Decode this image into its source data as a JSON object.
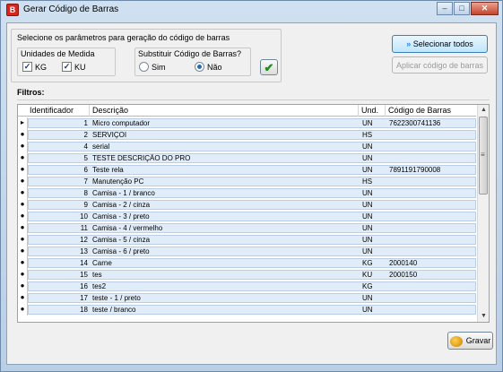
{
  "window": {
    "title": "Gerar Código de Barras",
    "app_icon_glyph": "B",
    "controls": {
      "minimize": "–",
      "maximize": "□",
      "close": "✕"
    }
  },
  "params": {
    "heading": "Selecione os parâmetros para geração do código de barras",
    "units_group_label": "Unidades de Medida",
    "unit_options": [
      {
        "label": "KG",
        "checked": true
      },
      {
        "label": "KU",
        "checked": true
      }
    ],
    "substituir_label": "Substituir Código de Barras?",
    "radio_sim": "Sim",
    "radio_nao": "Não",
    "selected": "Não"
  },
  "buttons": {
    "select_all": "Selecionar todos",
    "apply_barcode": "Aplicar código de barras",
    "save": "Gravar"
  },
  "filters_label": "Filtros:",
  "grid": {
    "columns": [
      "Identificador",
      "Descrição",
      "Und.",
      "Código de Barras"
    ],
    "rows": [
      {
        "id": "1",
        "desc": "Micro computador",
        "und": "UN",
        "barcode": "7622300741136",
        "indicator": "arrow"
      },
      {
        "id": "2",
        "desc": "SERVIÇOI",
        "und": "HS",
        "barcode": "",
        "indicator": "dot"
      },
      {
        "id": "4",
        "desc": "serial",
        "und": "UN",
        "barcode": "",
        "indicator": "dot"
      },
      {
        "id": "5",
        "desc": "TESTE DESCRIÇÃO DO PRO",
        "und": "UN",
        "barcode": "",
        "indicator": "dot"
      },
      {
        "id": "6",
        "desc": "Teste rela",
        "und": "UN",
        "barcode": "7891191790008",
        "indicator": "dot"
      },
      {
        "id": "7",
        "desc": "Manutenção PC",
        "und": "HS",
        "barcode": "",
        "indicator": "dot"
      },
      {
        "id": "8",
        "desc": "Camisa - 1 / branco",
        "und": "UN",
        "barcode": "",
        "indicator": "dot"
      },
      {
        "id": "9",
        "desc": "Camisa - 2 / cinza",
        "und": "UN",
        "barcode": "",
        "indicator": "dot"
      },
      {
        "id": "10",
        "desc": "Camisa - 3 / preto",
        "und": "UN",
        "barcode": "",
        "indicator": "dot"
      },
      {
        "id": "11",
        "desc": "Camisa - 4 / vermelho",
        "und": "UN",
        "barcode": "",
        "indicator": "dot"
      },
      {
        "id": "12",
        "desc": "Camisa - 5 / cinza",
        "und": "UN",
        "barcode": "",
        "indicator": "dot"
      },
      {
        "id": "13",
        "desc": "Camisa - 6 / preto",
        "und": "UN",
        "barcode": "",
        "indicator": "dot"
      },
      {
        "id": "14",
        "desc": "Carne",
        "und": "KG",
        "barcode": "2000140",
        "indicator": "dot"
      },
      {
        "id": "15",
        "desc": "tes",
        "und": "KU",
        "barcode": "2000150",
        "indicator": "dot"
      },
      {
        "id": "16",
        "desc": "tes2",
        "und": "KG",
        "barcode": "",
        "indicator": "dot"
      },
      {
        "id": "17",
        "desc": "teste - 1 / preto",
        "und": "UN",
        "barcode": "",
        "indicator": "dot"
      },
      {
        "id": "18",
        "desc": "teste   / branco",
        "und": "UN",
        "barcode": "",
        "indicator": "dot"
      }
    ]
  },
  "scrollbar": {
    "up_arrow": "▲",
    "down_arrow": "▼",
    "grip": "≡"
  },
  "icons": {
    "select_all_icon": "double-chevron-down-icon",
    "confirm_icon": "checkmark-icon",
    "save_icon": "save-icon"
  }
}
